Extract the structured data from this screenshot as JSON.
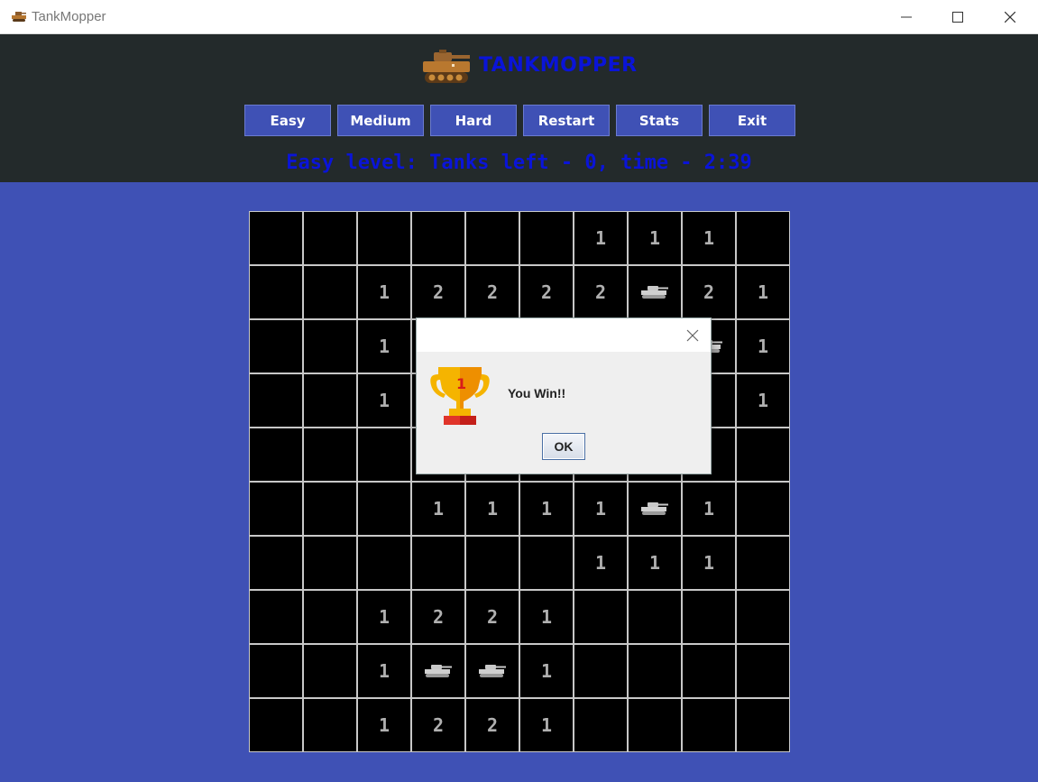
{
  "window": {
    "title": "TankMopper"
  },
  "header": {
    "brand": "TANKMOPPER",
    "buttons": [
      "Easy",
      "Medium",
      "Hard",
      "Restart",
      "Stats",
      "Exit"
    ],
    "status": "Easy level: Tanks left - 0, time - 2:39"
  },
  "board": {
    "rows": [
      [
        "",
        "",
        "",
        "",
        "",
        "",
        "1",
        "1",
        "1",
        ""
      ],
      [
        "",
        "",
        "1",
        "2",
        "2",
        "2",
        "2",
        "tank",
        "2",
        "1"
      ],
      [
        "",
        "",
        "1",
        "",
        "",
        "",
        "",
        "",
        "tank",
        "1"
      ],
      [
        "",
        "",
        "1",
        "",
        "",
        "",
        "",
        "",
        "",
        "1"
      ],
      [
        "",
        "",
        "",
        "",
        "",
        "",
        "",
        "",
        "",
        ""
      ],
      [
        "",
        "",
        "",
        "1",
        "1",
        "1",
        "1",
        "tank",
        "1",
        ""
      ],
      [
        "",
        "",
        "",
        "",
        "",
        "",
        "1",
        "1",
        "1",
        ""
      ],
      [
        "",
        "",
        "1",
        "2",
        "2",
        "1",
        "",
        "",
        "",
        ""
      ],
      [
        "",
        "",
        "1",
        "tank",
        "tank",
        "1",
        "",
        "",
        "",
        ""
      ],
      [
        "",
        "",
        "1",
        "2",
        "2",
        "1",
        "",
        "",
        "",
        ""
      ]
    ]
  },
  "dialog": {
    "message": "You Win!!",
    "ok_label": "OK",
    "trophy_rank": "1"
  },
  "colors": {
    "background": "#3f51b5",
    "header": "#232a2b",
    "accent_text": "#0a14d8",
    "cell": "#000000",
    "digit": "#b0b0b0"
  }
}
